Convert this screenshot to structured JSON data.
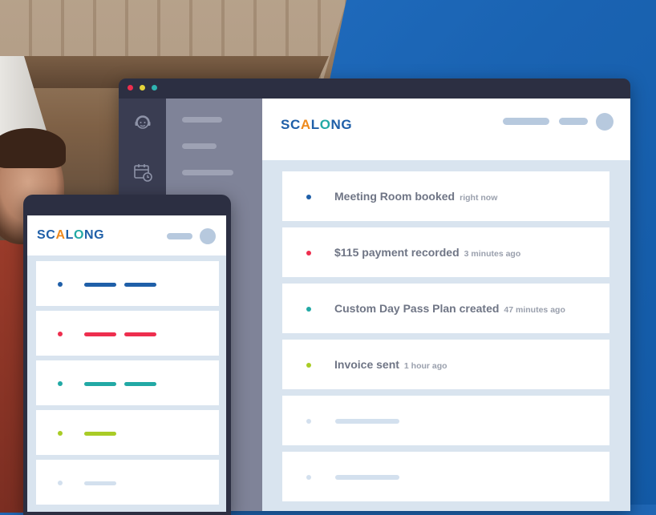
{
  "brand": {
    "logo_parts": [
      "SC",
      "A",
      "L",
      "O",
      "NG"
    ],
    "colors": {
      "navy": "#1f5fa8",
      "red": "#ee2e4e",
      "teal": "#22a9a5",
      "lime": "#a9cc26",
      "placeholder": "#d3e0ee"
    }
  },
  "window": {
    "controls": [
      "close",
      "minimize",
      "zoom"
    ],
    "rail_icons": [
      "support-agent-icon",
      "calendar-clock-icon"
    ]
  },
  "activity": [
    {
      "title": "Meeting Room booked",
      "time": "right now",
      "color": "#1f5fa8"
    },
    {
      "title": "$115 payment recorded",
      "time": "3 minutes ago",
      "color": "#ee2e4e"
    },
    {
      "title": "Custom Day Pass Plan created",
      "time": "47 minutes ago",
      "color": "#22a9a5"
    },
    {
      "title": "Invoice sent",
      "time": "1 hour ago",
      "color": "#a9cc26"
    }
  ],
  "mobile": {
    "items": [
      {
        "color": "#1f5fa8",
        "bars": 2
      },
      {
        "color": "#ee2e4e",
        "bars": 2
      },
      {
        "color": "#22a9a5",
        "bars": 2
      },
      {
        "color": "#a9cc26",
        "bars": 1
      },
      {
        "color": "#d3e0ee",
        "bars": 1
      }
    ]
  }
}
